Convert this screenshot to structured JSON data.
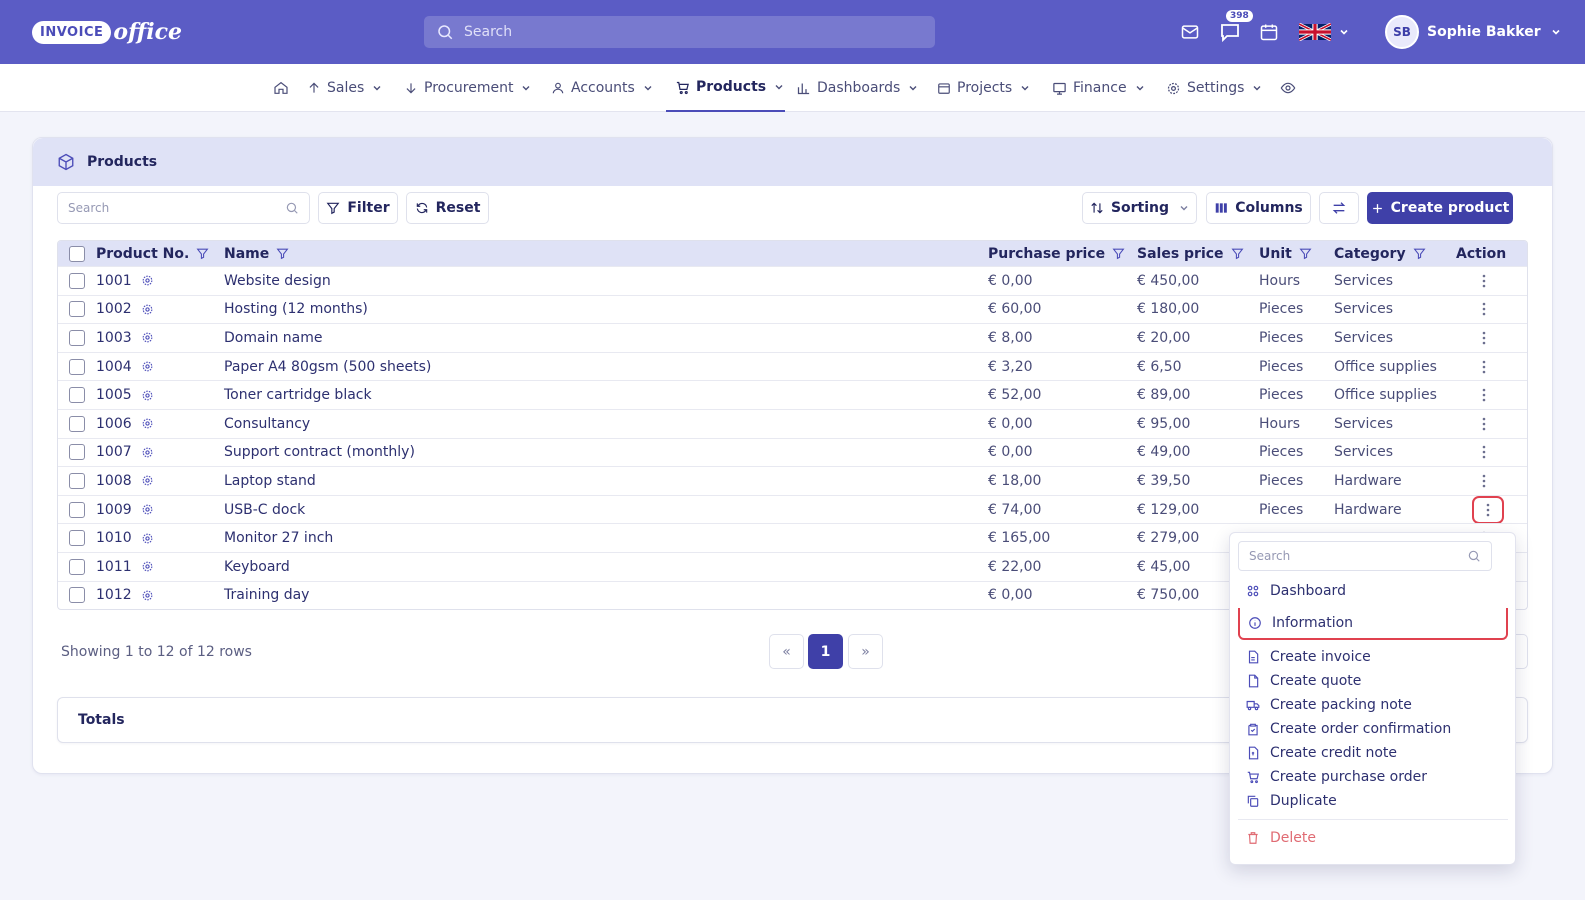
{
  "app": {
    "logo_badge": "INVOICE",
    "logo_text": "office",
    "search_placeholder": "Search",
    "notification_count": "398",
    "user_initials": "SB",
    "user_name": "Sophie Bakker"
  },
  "nav": {
    "items": [
      {
        "label": "Sales"
      },
      {
        "label": "Procurement"
      },
      {
        "label": "Accounts"
      },
      {
        "label": "Products"
      },
      {
        "label": "Dashboards"
      },
      {
        "label": "Projects"
      },
      {
        "label": "Finance"
      },
      {
        "label": "Settings"
      }
    ]
  },
  "page": {
    "title": "Products",
    "search_placeholder": "Search",
    "filter_label": "Filter",
    "reset_label": "Reset",
    "sorting_label": "Sorting",
    "columns_label": "Columns",
    "create_label": "Create product"
  },
  "table": {
    "headers": {
      "product_no": "Product No.",
      "name": "Name",
      "purchase_price": "Purchase price",
      "sales_price": "Sales price",
      "unit": "Unit",
      "category": "Category",
      "action": "Action"
    },
    "rows": [
      {
        "no": "1001",
        "name": "Website design",
        "purchase": "€ 0,00",
        "sales": "€ 450,00",
        "unit": "Hours",
        "category": "Services"
      },
      {
        "no": "1002",
        "name": "Hosting (12 months)",
        "purchase": "€ 60,00",
        "sales": "€ 180,00",
        "unit": "Pieces",
        "category": "Services"
      },
      {
        "no": "1003",
        "name": "Domain name",
        "purchase": "€ 8,00",
        "sales": "€ 20,00",
        "unit": "Pieces",
        "category": "Services"
      },
      {
        "no": "1004",
        "name": "Paper A4 80gsm (500 sheets)",
        "purchase": "€ 3,20",
        "sales": "€ 6,50",
        "unit": "Pieces",
        "category": "Office supplies"
      },
      {
        "no": "1005",
        "name": "Toner cartridge black",
        "purchase": "€ 52,00",
        "sales": "€ 89,00",
        "unit": "Pieces",
        "category": "Office supplies"
      },
      {
        "no": "1006",
        "name": "Consultancy",
        "purchase": "€ 0,00",
        "sales": "€ 95,00",
        "unit": "Hours",
        "category": "Services"
      },
      {
        "no": "1007",
        "name": "Support contract (monthly)",
        "purchase": "€ 0,00",
        "sales": "€ 49,00",
        "unit": "Pieces",
        "category": "Services"
      },
      {
        "no": "1008",
        "name": "Laptop stand",
        "purchase": "€ 18,00",
        "sales": "€ 39,50",
        "unit": "Pieces",
        "category": "Hardware"
      },
      {
        "no": "1009",
        "name": "USB-C dock",
        "purchase": "€ 74,00",
        "sales": "€ 129,00",
        "unit": "Pieces",
        "category": "Hardware"
      },
      {
        "no": "1010",
        "name": "Monitor 27 inch",
        "purchase": "€ 165,00",
        "sales": "€ 279,00",
        "unit": "",
        "category": ""
      },
      {
        "no": "1011",
        "name": "Keyboard",
        "purchase": "€ 22,00",
        "sales": "€ 45,00",
        "unit": "",
        "category": ""
      },
      {
        "no": "1012",
        "name": "Training day",
        "purchase": "€ 0,00",
        "sales": "€ 750,00",
        "unit": "",
        "category": ""
      }
    ]
  },
  "footer": {
    "showing": "Showing 1 to 12 of 12 rows",
    "prev": "«",
    "current_page": "1",
    "next": "»",
    "totals_label": "Totals"
  },
  "action_menu": {
    "search_placeholder": "Search",
    "items": [
      {
        "label": "Dashboard"
      },
      {
        "label": "Information"
      },
      {
        "label": "Create invoice"
      },
      {
        "label": "Create quote"
      },
      {
        "label": "Create packing note"
      },
      {
        "label": "Create order confirmation"
      },
      {
        "label": "Create credit note"
      },
      {
        "label": "Create purchase order"
      },
      {
        "label": "Duplicate"
      },
      {
        "label": "Delete"
      }
    ]
  },
  "colors": {
    "brand": "#5b5cc5",
    "primary": "#3f40a8",
    "highlight": "#e0414f"
  }
}
